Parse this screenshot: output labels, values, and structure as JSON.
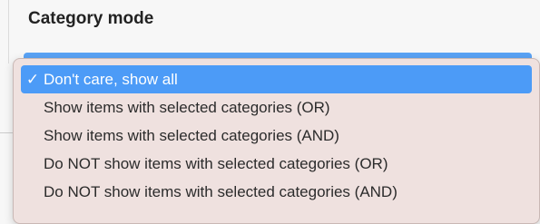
{
  "field": {
    "title": "Category mode"
  },
  "menu": {
    "check_glyph": "✓",
    "items": [
      {
        "label": "Don't care, show all",
        "selected": true
      },
      {
        "label": "Show items with selected categories (OR)",
        "selected": false
      },
      {
        "label": "Show items with selected categories (AND)",
        "selected": false
      },
      {
        "label": "Do NOT show items with selected categories (OR)",
        "selected": false
      },
      {
        "label": "Do NOT show items with selected categories (AND)",
        "selected": false
      }
    ]
  },
  "colors": {
    "selection": "#4c9bf7",
    "menu_background": "#efe1df"
  }
}
